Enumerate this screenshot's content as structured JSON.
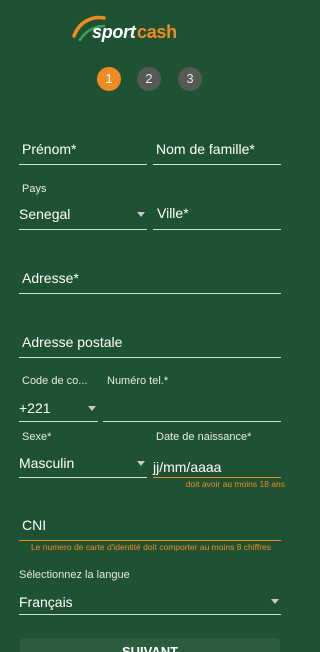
{
  "header": {
    "logo_part1": "sport",
    "logo_part2": "cash",
    "back_icon": "arrow-left-icon"
  },
  "steps": [
    "1",
    "2",
    "3"
  ],
  "form": {
    "prenom": "Prénom*",
    "nom": "Nom de famille*",
    "pays_label": "Pays",
    "pays_value": "Senegal",
    "ville": "Ville*",
    "adresse": "Adresse*",
    "adresse_postale": "Adresse postale",
    "code_label": "Code de co...",
    "code_value": "+221",
    "tel_label": "Numéro tel.*",
    "sexe_label": "Sexe*",
    "sexe_value": "Masculin",
    "dob_label": "Date de naissance*",
    "dob_placeholder": "jj/mm/aaaa",
    "dob_error": "doit avoir au moins 18 ans",
    "cni": "CNI",
    "cni_error": "Le numero de carte d'identité doit comporter au moins 8 chiffres",
    "langue_label": "Sélectionnez la langue",
    "langue_value": "Français"
  },
  "button": {
    "label": "SUIVANT"
  },
  "colors": {
    "background": "#1f5233",
    "accent": "#f08a24",
    "inactive_step": "#555a57"
  }
}
